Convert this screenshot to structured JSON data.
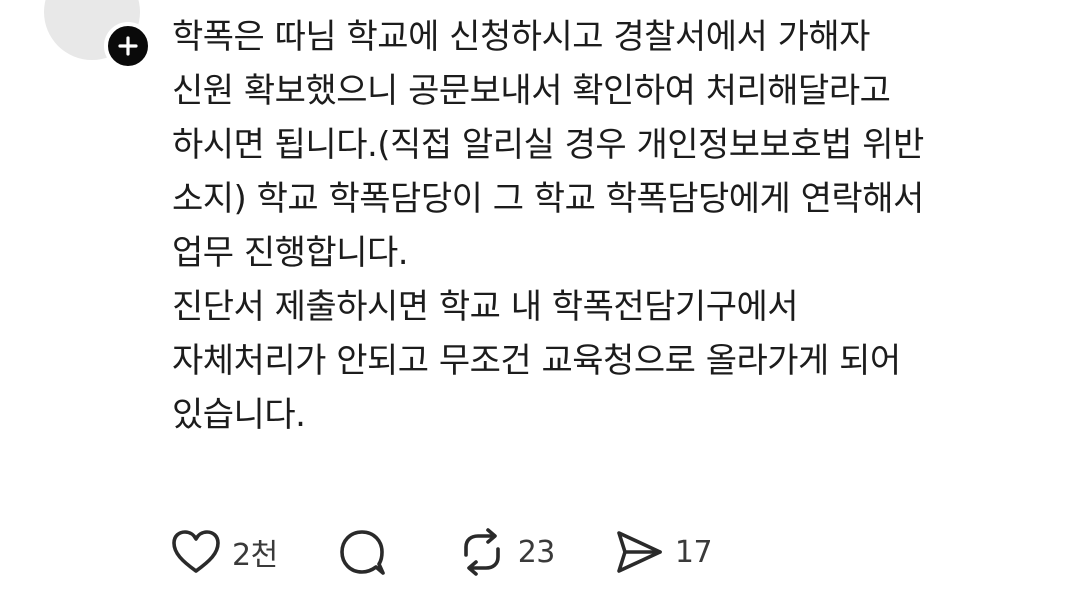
{
  "post": {
    "lines": [
      "학폭은 따님 학교에 신청하시고 경찰서에서 가해자",
      "신원 확보했으니 공문보내서 확인하여 처리해달라고",
      "하시면 됩니다.(직접 알리실 경우 개인정보보호법 위반",
      "소지) 학교 학폭담당이 그 학교 학폭담당에게 연락해서",
      "업무 진행합니다.",
      "진단서 제출하시면 학교 내 학폭전담기구에서",
      "자체처리가 안되고 무조건 교육청으로 올라가게 되어",
      "있습니다."
    ]
  },
  "actions": {
    "like": {
      "icon": "heart-icon",
      "count": "2천"
    },
    "reply": {
      "icon": "speech-bubble-icon",
      "count": ""
    },
    "repost": {
      "icon": "repost-icon",
      "count": "23"
    },
    "share": {
      "icon": "send-icon",
      "count": "17"
    }
  },
  "follow_badge": {
    "icon": "plus-icon"
  },
  "colors": {
    "text": "#1c1c1c",
    "count": "#3a3a3a",
    "icon": "#2a2a2a",
    "badge": "#0a0a0a",
    "avatar": "#e8e8e8"
  }
}
